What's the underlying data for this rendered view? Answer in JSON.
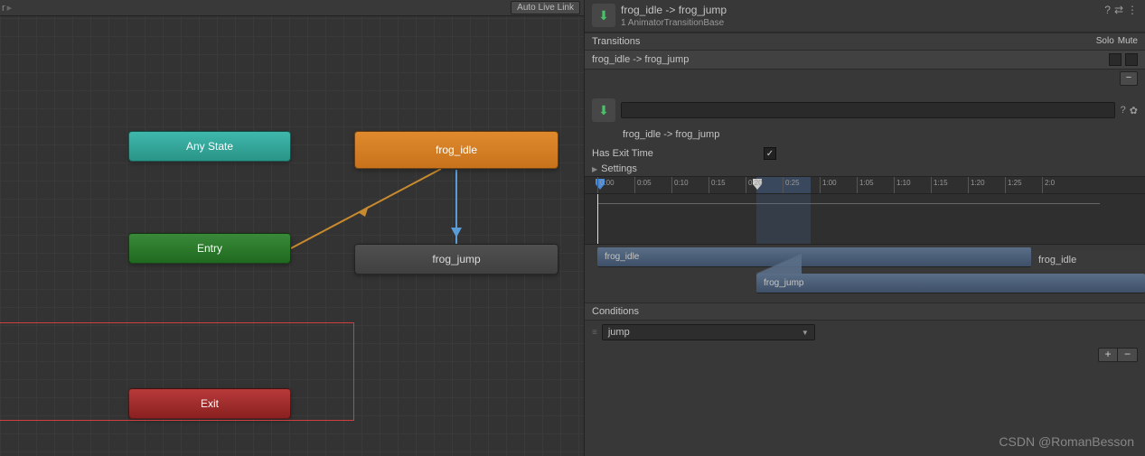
{
  "toolbar": {
    "auto_live_link": "Auto Live Link",
    "breadcrumb": "r"
  },
  "graph": {
    "any_state": "Any State",
    "entry": "Entry",
    "exit": "Exit",
    "frog_idle": "frog_idle",
    "frog_jump": "frog_jump"
  },
  "inspector": {
    "title": "frog_idle -> frog_jump",
    "subtitle": "1 AnimatorTransitionBase",
    "transitions_header": "Transitions",
    "solo_label": "Solo",
    "mute_label": "Mute",
    "transition_item": "frog_idle -> frog_jump",
    "name_label": "frog_idle -> frog_jump",
    "has_exit_time_label": "Has Exit Time",
    "has_exit_time_checked": "✓",
    "settings_label": "Settings",
    "timeline_ticks": [
      "0:00",
      "0:05",
      "0:10",
      "0:15",
      "0:20",
      "0:25",
      "1:00",
      "1:05",
      "1:10",
      "1:15",
      "1:20",
      "1:25",
      "2:0"
    ],
    "clip_src": "frog_idle",
    "clip_src2": "frog_idle",
    "clip_dst": "frog_jump",
    "conditions_header": "Conditions",
    "condition_param": "jump"
  },
  "watermark": "CSDN @RomanBesson"
}
